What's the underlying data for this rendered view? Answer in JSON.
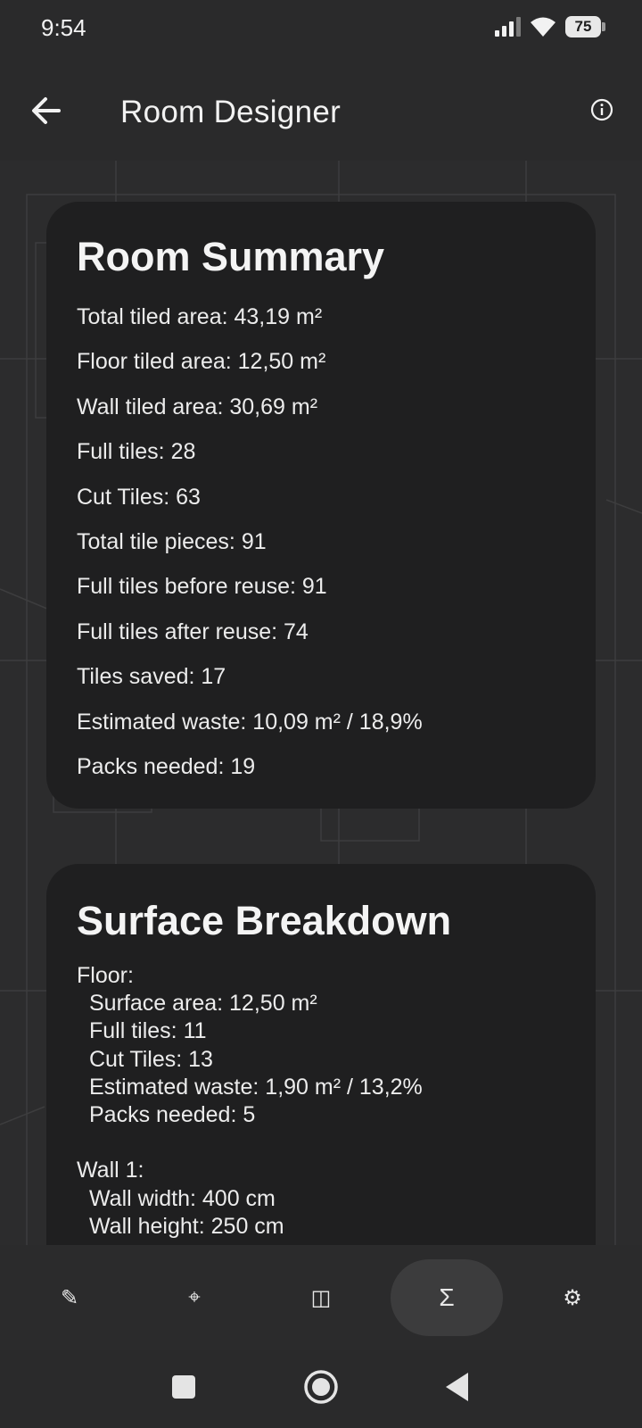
{
  "status_bar": {
    "time": "9:54",
    "battery": "75"
  },
  "app_bar": {
    "title": "Room Designer"
  },
  "summary": {
    "title": "Room Summary",
    "lines": [
      "Total tiled area: 43,19 m²",
      "Floor tiled area: 12,50 m²",
      "Wall tiled area: 30,69 m²",
      "Full tiles: 28",
      "Cut Tiles: 63",
      "Total tile pieces: 91",
      "Full tiles before reuse: 91",
      "Full tiles after reuse: 74",
      "Tiles saved: 17",
      "Estimated waste: 10,09 m² / 18,9%",
      "Packs needed: 19"
    ]
  },
  "breakdown": {
    "title": "Surface Breakdown",
    "floor": {
      "heading": "Floor:",
      "lines": [
        "Surface area: 12,50 m²",
        "Full tiles: 11",
        "Cut Tiles: 13",
        "Estimated waste: 1,90 m² / 13,2%",
        "Packs needed: 5"
      ]
    },
    "wall1": {
      "heading": "Wall 1:",
      "lines": [
        "Wall width: 400 cm",
        "Wall height: 250 cm"
      ]
    }
  },
  "bottom_nav": {
    "items": [
      {
        "icon": "✎",
        "name": "draw"
      },
      {
        "icon": "⌖",
        "name": "measure"
      },
      {
        "icon": "◫",
        "name": "walls"
      },
      {
        "icon": "Σ",
        "name": "summary"
      },
      {
        "icon": "⚙",
        "name": "settings"
      }
    ],
    "active_index": 3
  },
  "colors": {
    "background": "#2a2a2b",
    "card": "#1f1f20",
    "active_nav": "#3c3c3d",
    "text": "#f0f0f0"
  }
}
